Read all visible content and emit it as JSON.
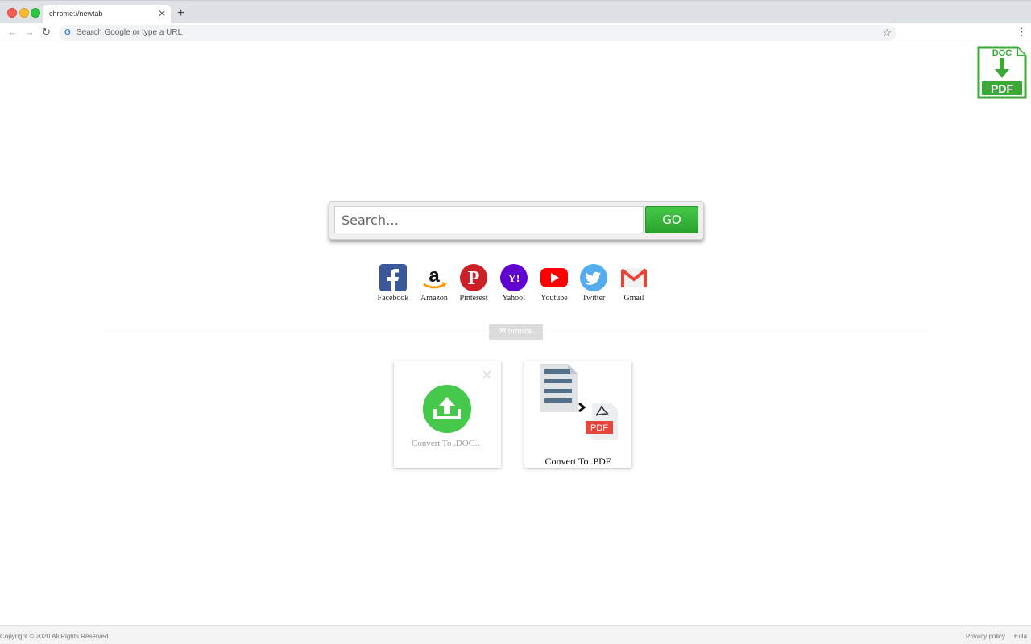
{
  "browser": {
    "tab_title": "chrome://newtab",
    "tab_close": "✕",
    "new_tab": "+",
    "omnibox_placeholder": "Search Google or type a URL",
    "back_icon": "←",
    "forward_icon": "→",
    "reload_icon": "↻",
    "star_icon": "☆",
    "menu_icon": "⋮",
    "google_icon": "G"
  },
  "logo": {
    "top_text": "DOC",
    "bottom_text": "PDF",
    "color": "#3aa935"
  },
  "search": {
    "placeholder": "Search…",
    "go_label": "GO"
  },
  "shortcuts": [
    {
      "label": "Facebook",
      "icon": "facebook-icon",
      "glyph": "f",
      "color": "#3b5998"
    },
    {
      "label": "Amazon",
      "icon": "amazon-icon",
      "glyph": "a",
      "color": "#ffffff"
    },
    {
      "label": "Pinterest",
      "icon": "pinterest-icon",
      "glyph": "P",
      "color": "#cb2027"
    },
    {
      "label": "Yahoo!",
      "icon": "yahoo-icon",
      "glyph": "Y!",
      "color": "#6001d2"
    },
    {
      "label": "Youtube",
      "icon": "youtube-icon",
      "glyph": "▶",
      "color": "#ff0000"
    },
    {
      "label": "Twitter",
      "icon": "twitter-icon",
      "glyph": "t",
      "color": "#55acee"
    },
    {
      "label": "Gmail",
      "icon": "gmail-icon",
      "glyph": "M",
      "color": "#ea4335"
    }
  ],
  "minimize_label": "Minimize",
  "cards": {
    "doc": {
      "label": "Convert To .DOC…",
      "close": "✕",
      "icon_color": "#46c84b"
    },
    "pdf": {
      "label": "Convert To .PDF",
      "badge": "PDF",
      "badge_color": "#e8453c"
    }
  },
  "footer": {
    "copyright": "Copyright © 2020 All Rights Reserved.",
    "privacy": "Privacy policy",
    "eula": "Eula"
  }
}
